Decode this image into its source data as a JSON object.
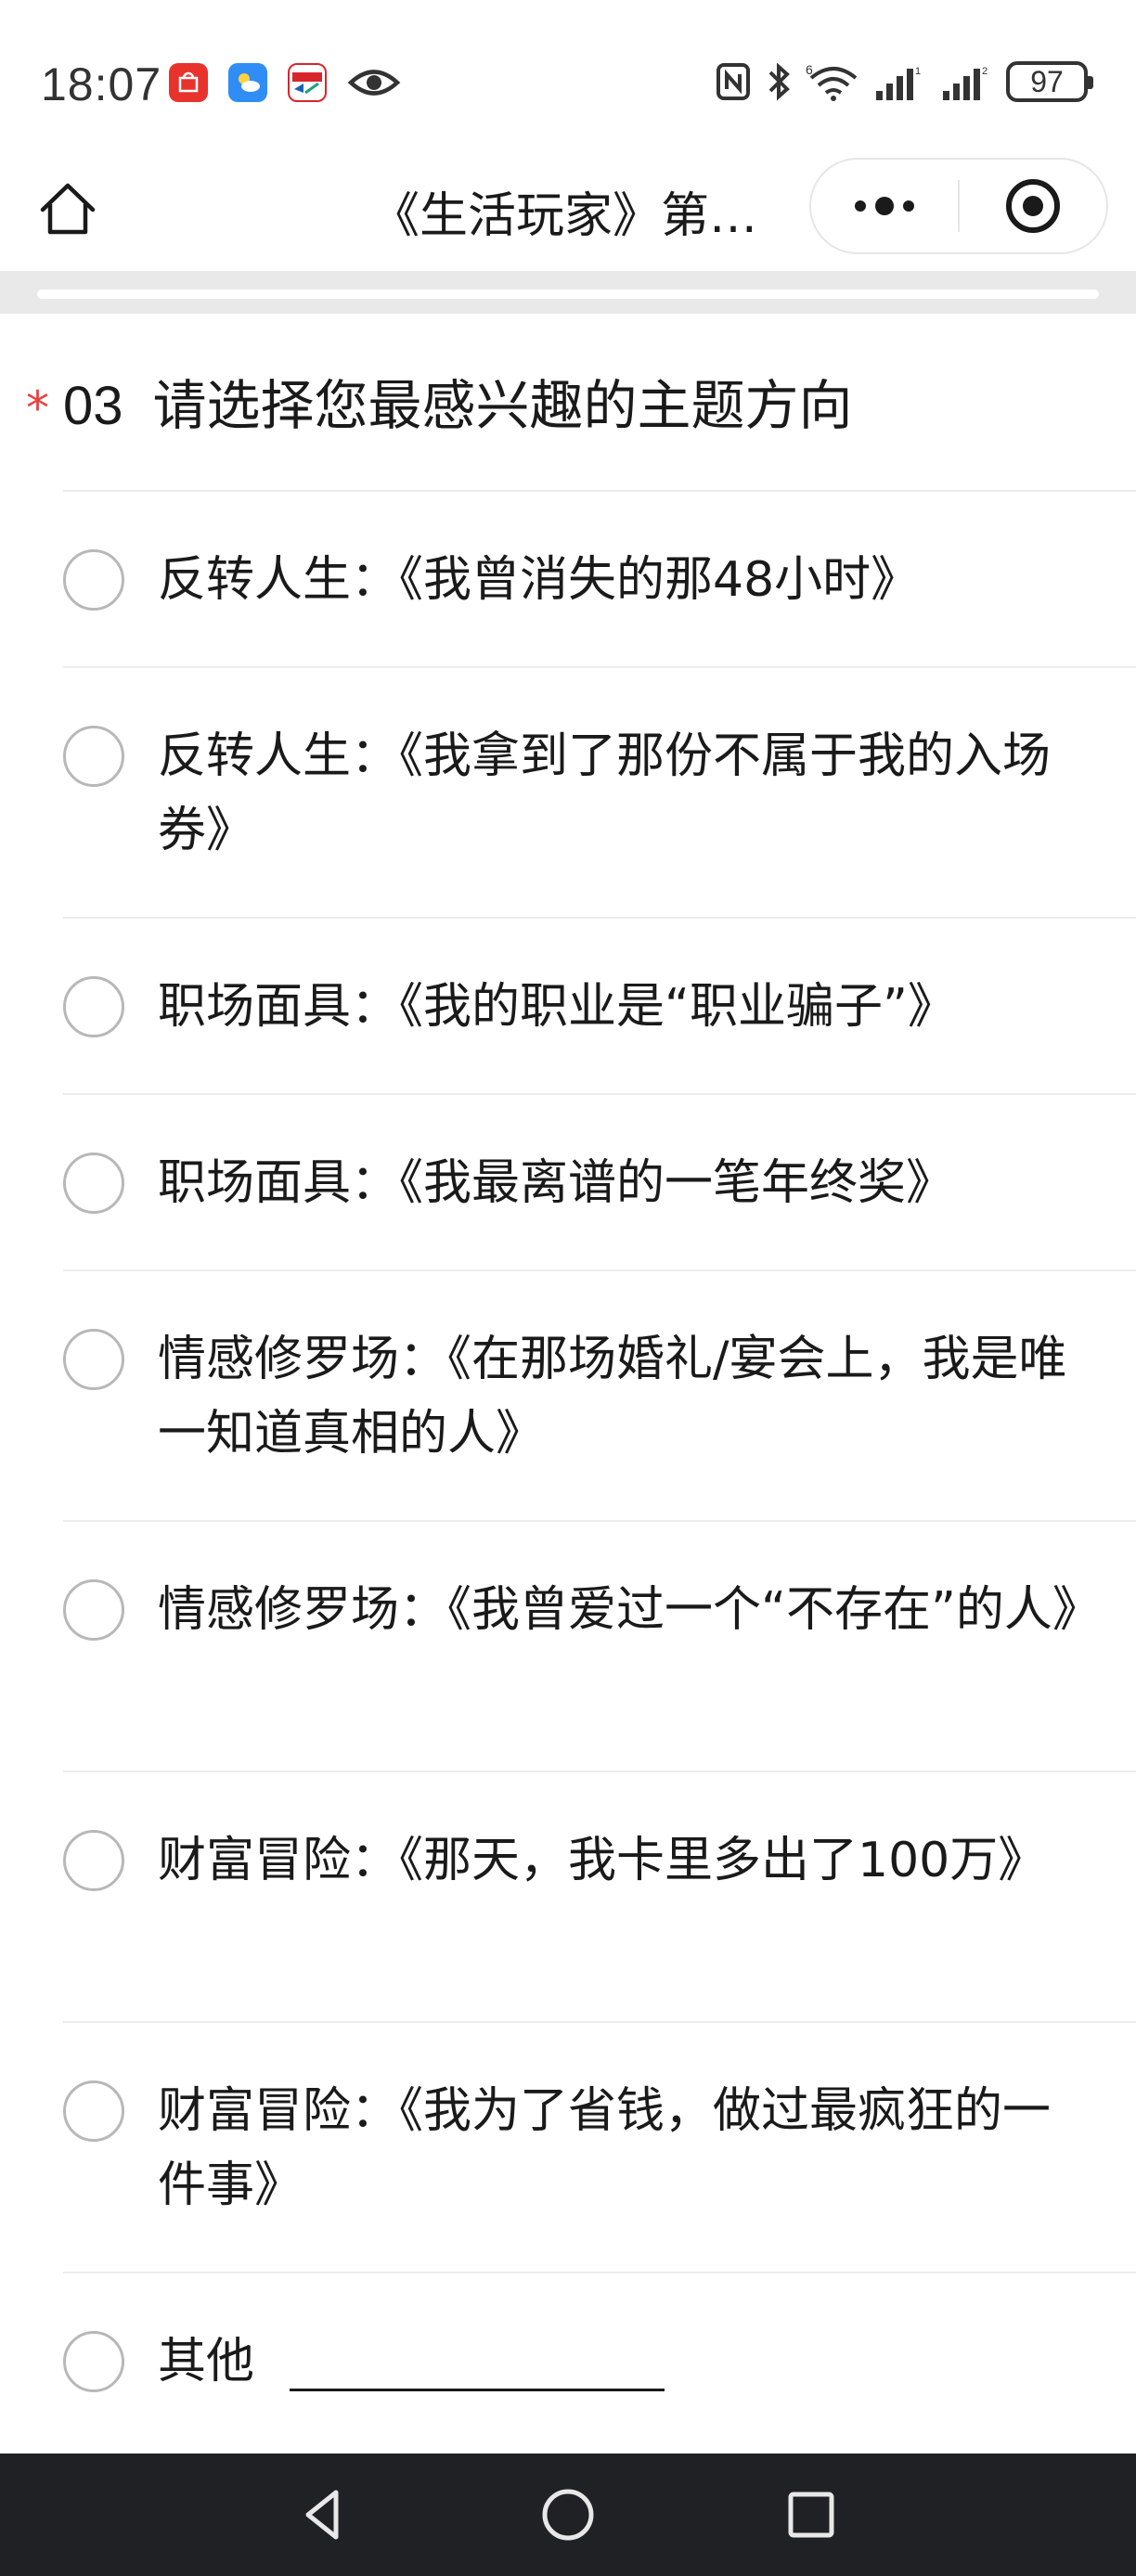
{
  "status_bar": {
    "time": "18:07",
    "battery": "97",
    "notif_icons": [
      "huawei-appgallery-icon",
      "weather-app-icon",
      "unionpay-app-icon",
      "eye-icon"
    ],
    "sys_icons": [
      "nfc-icon",
      "bluetooth-icon",
      "wifi-6-icon",
      "signal-icon",
      "signal-icon"
    ]
  },
  "nav": {
    "title": "《生活玩家》第…",
    "home_icon": "home-icon",
    "more_icon": "more-icon",
    "close_icon": "target-close-icon"
  },
  "question": {
    "required_mark": "*",
    "number": "03",
    "title": "请选择您最感兴趣的主题方向",
    "options": [
      {
        "label": "反转人生：《我曾消失的那48小时》"
      },
      {
        "label": "反转人生：《我拿到了那份不属于我的入场券》"
      },
      {
        "label": "职场面具：《我的职业是“职业骗子”》"
      },
      {
        "label": "职场面具：《我最离谱的一笔年终奖》"
      },
      {
        "label": "情感修罗场：《在那场婚礼/宴会上，我是唯一知道真相的人》"
      },
      {
        "label": "情感修罗场：《我曾爱过一个“不存在”的人》"
      },
      {
        "label": "财富冒险：《那天，我卡里多出了100万》"
      },
      {
        "label": "财富冒险：《我为了省钱，做过最疯狂的一件事》"
      },
      {
        "label": "其他"
      }
    ]
  },
  "system_nav": {
    "back_icon": "back-triangle-icon",
    "home_icon": "home-circle-icon",
    "recents_icon": "recents-square-icon",
    "background": "#202124"
  },
  "colors": {
    "required": "#e64340",
    "radio_border": "#b8b8b8",
    "divider": "#ececec"
  }
}
